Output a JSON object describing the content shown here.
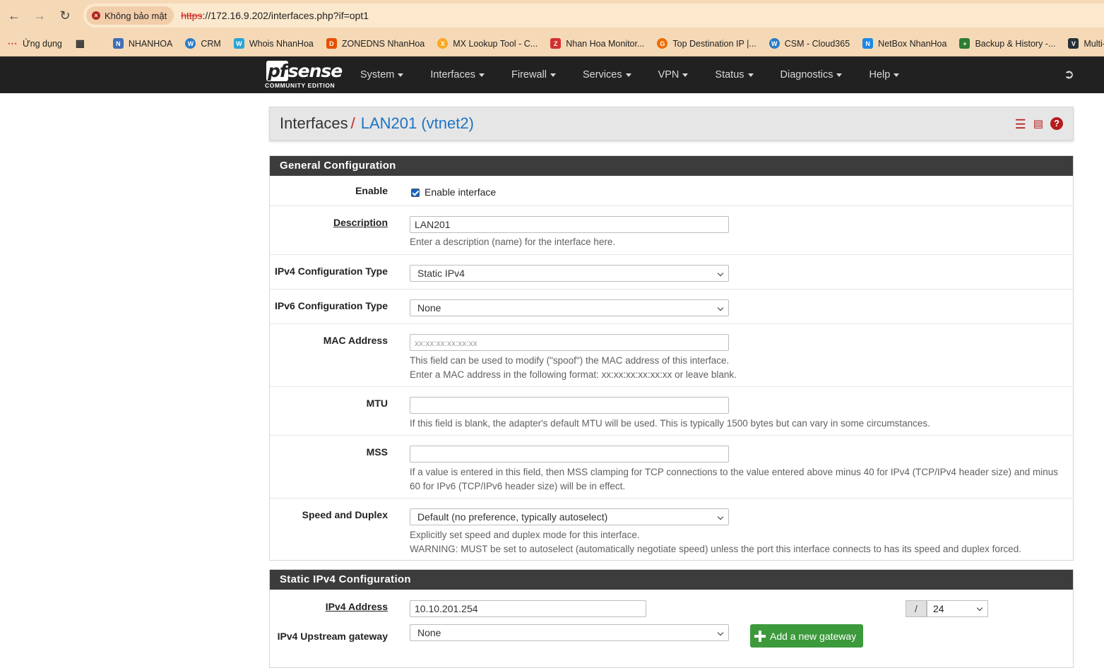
{
  "browser": {
    "security_label": "Không bảo mật",
    "url_protocol": "https",
    "url_rest": "://172.16.9.202/interfaces.php?if=opt1",
    "bookmarks": [
      {
        "label": "Ứng dụng",
        "icon": "apps-grid-icon",
        "color": "#e53935"
      },
      {
        "label": "NHANHOA",
        "icon": "nhanhoa-icon",
        "color": "#3f6fb6"
      },
      {
        "label": "CRM",
        "icon": "crm-icon",
        "color": "#2a7cc7"
      },
      {
        "label": "Whois NhanHoa",
        "icon": "whois-icon",
        "color": "#2aa4d5"
      },
      {
        "label": "ZONEDNS NhanHoa",
        "icon": "zonedns-icon",
        "color": "#e65100"
      },
      {
        "label": "MX Lookup Tool - C...",
        "icon": "mx-lookup-icon",
        "color": "#f9a825"
      },
      {
        "label": "Nhan Hoa Monitor...",
        "icon": "zabbix-icon",
        "color": "#d32f2f"
      },
      {
        "label": "Top Destination IP |...",
        "icon": "grafana-icon",
        "color": "#ef6c00"
      },
      {
        "label": "CSM - Cloud365",
        "icon": "csm-icon",
        "color": "#2a7cc7"
      },
      {
        "label": "NetBox NhanHoa",
        "icon": "netbox-icon",
        "color": "#1e88e5"
      },
      {
        "label": "Backup & History -...",
        "icon": "backup-icon",
        "color": "#2e7d32"
      },
      {
        "label": "Multi-Area OSPF",
        "icon": "ospf-icon",
        "color": "#263238"
      }
    ]
  },
  "nav": {
    "logo_text": "sense",
    "logo_pf": "pf",
    "logo_sub": "COMMUNITY EDITION",
    "menu": [
      "System",
      "Interfaces",
      "Firewall",
      "Services",
      "VPN",
      "Status",
      "Diagnostics",
      "Help"
    ]
  },
  "header": {
    "section": "Interfaces",
    "separator": "/",
    "page": "LAN201 (vtnet2)"
  },
  "general": {
    "title": "General Configuration",
    "enable_label": "Enable",
    "enable_checkbox_label": "Enable interface",
    "description_label": "Description",
    "description_value": "LAN201",
    "description_help": "Enter a description (name) for the interface here.",
    "ipv4_type_label": "IPv4 Configuration Type",
    "ipv4_type_value": "Static IPv4",
    "ipv6_type_label": "IPv6 Configuration Type",
    "ipv6_type_value": "None",
    "mac_label": "MAC Address",
    "mac_placeholder": "xx:xx:xx:xx:xx:xx",
    "mac_help_1": "This field can be used to modify (\"spoof\") the MAC address of this interface.",
    "mac_help_2": "Enter a MAC address in the following format: xx:xx:xx:xx:xx:xx or leave blank.",
    "mtu_label": "MTU",
    "mtu_help": "If this field is blank, the adapter's default MTU will be used. This is typically 1500 bytes but can vary in some circumstances.",
    "mss_label": "MSS",
    "mss_help": "If a value is entered in this field, then MSS clamping for TCP connections to the value entered above minus 40 for IPv4 (TCP/IPv4 header size) and minus 60 for IPv6 (TCP/IPv6 header size) will be in effect.",
    "speed_label": "Speed and Duplex",
    "speed_value": "Default (no preference, typically autoselect)",
    "speed_help_1": "Explicitly set speed and duplex mode for this interface.",
    "speed_help_2": "WARNING: MUST be set to autoselect (automatically negotiate speed) unless the port this interface connects to has its speed and duplex forced."
  },
  "static_ipv4": {
    "title": "Static IPv4 Configuration",
    "address_label": "IPv4 Address",
    "address_value": "10.10.201.254",
    "cidr_slash": "/",
    "cidr_value": "24",
    "gateway_label": "IPv4 Upstream gateway",
    "gateway_value": "None",
    "add_gateway_label": "Add a new gateway"
  }
}
